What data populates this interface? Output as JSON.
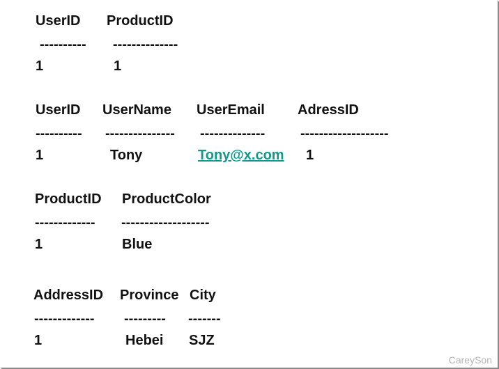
{
  "blocks": [
    {
      "headers": [
        "UserID",
        "ProductID"
      ],
      "dashes": [
        "----------",
        "--------------"
      ],
      "values": [
        "1",
        "1"
      ]
    },
    {
      "headers": [
        "UserID",
        "UserName",
        "UserEmail",
        "AdressID"
      ],
      "dashes": [
        "----------",
        "---------------",
        "--------------",
        "-------------------"
      ],
      "values": [
        "1",
        "Tony",
        "Tony@x.com",
        "1"
      ]
    },
    {
      "headers": [
        "ProductID",
        "ProductColor"
      ],
      "dashes": [
        "-------------",
        "-------------------"
      ],
      "values": [
        "1",
        "Blue"
      ]
    },
    {
      "headers": [
        "AddressID",
        "Province",
        "City"
      ],
      "dashes": [
        "-------------",
        "---------",
        "-------"
      ],
      "values": [
        "1",
        "Hebei",
        "SJZ"
      ]
    }
  ],
  "watermark": "CareySon",
  "colors": {
    "text": "#111111",
    "link": "#109a8f",
    "watermark": "#b4b4b4"
  }
}
